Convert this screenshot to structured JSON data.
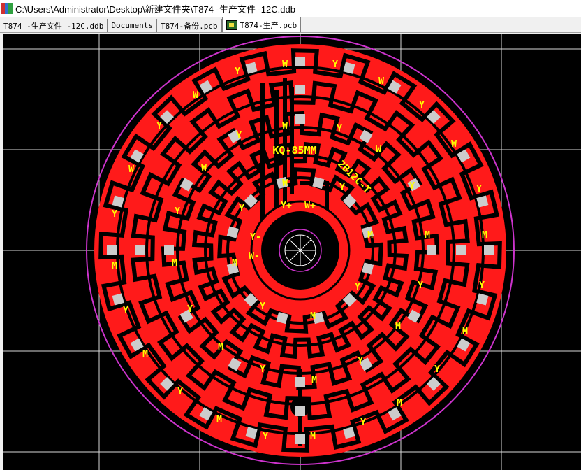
{
  "window": {
    "title": "C:\\Users\\Administrator\\Desktop\\新建文件夹\\T874 -生产文件 -12C.ddb"
  },
  "tabs": [
    {
      "label": "T874 -生产文件 -12C.ddb",
      "active": false
    },
    {
      "label": "Documents",
      "active": false
    },
    {
      "label": "T874-备份.pcb",
      "active": false
    },
    {
      "label": "T874-生产.pcb",
      "active": true,
      "icon": "pcb-document-icon"
    }
  ],
  "board": {
    "outline_color": "#cc33cc",
    "copper_color": "#ff1a1a",
    "track_color": "#000000",
    "pad_color": "#cccccc",
    "silk_color": "#ffff00",
    "labels": {
      "part": "KQ-85MM",
      "model": "2B12C-T",
      "y_plus": "Y+",
      "w_plus": "W+",
      "y_minus": "Y-",
      "w_minus": "W-",
      "y": "Y",
      "w": "W",
      "m": "M"
    }
  }
}
